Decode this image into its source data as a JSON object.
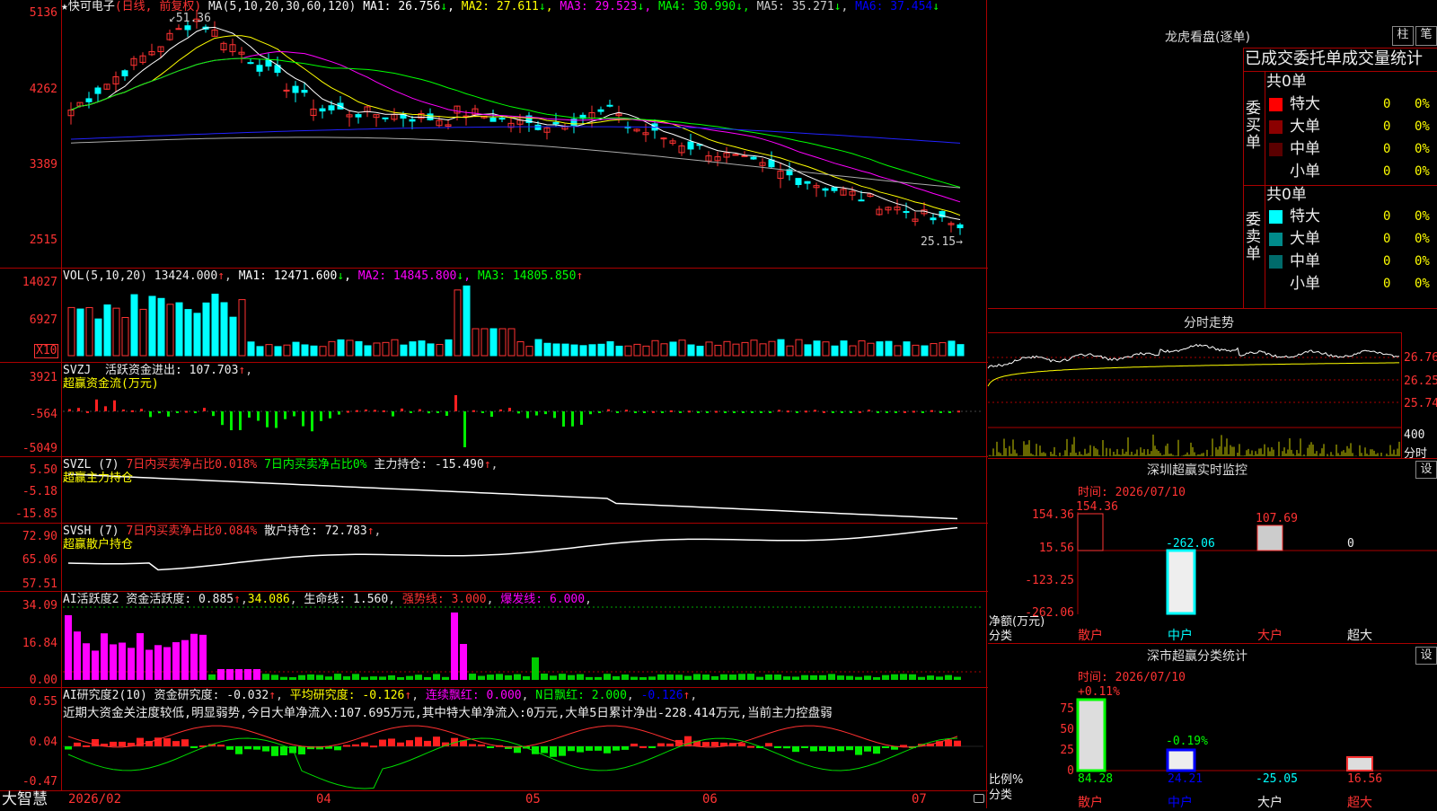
{
  "main": {
    "stock_name": "快可电子",
    "period_label": "(日线, 前复权)",
    "ma_header": "MA(5,10,20,30,60,120)",
    "ma": [
      {
        "label": "MA1:",
        "value": "26.756",
        "arrow": "↓",
        "color": "#ffffff"
      },
      {
        "label": "MA2:",
        "value": "27.611",
        "arrow": "↓",
        "color": "#ffff00"
      },
      {
        "label": "MA3:",
        "value": "29.523",
        "arrow": "↓",
        "color": "#ff00ff"
      },
      {
        "label": "MA4:",
        "value": "30.990",
        "arrow": "↓",
        "color": "#00ff00"
      },
      {
        "label": "MA5:",
        "value": "35.271",
        "arrow": "↓",
        "color": "#cccccc"
      },
      {
        "label": "MA6:",
        "value": "37.454",
        "arrow": "↓",
        "color": "#0000ff"
      }
    ],
    "high_label": "51.36",
    "low_label": "25.15",
    "y_ticks": [
      "5136",
      "4262",
      "3389",
      "2515"
    ]
  },
  "vol": {
    "header": "VOL(5,10,20)",
    "value": "13424.000",
    "ma": [
      {
        "label": "MA1:",
        "value": "12471.600",
        "arrow": "↓",
        "color": "#ffffff"
      },
      {
        "label": "MA2:",
        "value": "14845.800",
        "arrow": "↓",
        "color": "#ff00ff"
      },
      {
        "label": "MA3:",
        "value": "14805.850",
        "arrow": "↑",
        "color": "#00ff00"
      }
    ],
    "y_ticks": [
      "14027",
      "6927"
    ],
    "unit": "X10"
  },
  "svzj": {
    "name": "SVZJ",
    "label": "活跃资金进出:",
    "value": "107.703",
    "arrow": "↑",
    "sub": "超赢资金流(万元)",
    "y_ticks": [
      "3921",
      "-564",
      "-5049"
    ]
  },
  "svzl": {
    "name": "SVZL (7)",
    "a": "7日内买卖净占比0.018%",
    "b": "7日内买卖净占比0%",
    "c_label": "主力持仓:",
    "c_value": "-15.490",
    "arrow": "↑",
    "sub": "超赢主力持仓",
    "y_ticks": [
      "5.50",
      "-5.18",
      "-15.85"
    ]
  },
  "svsh": {
    "name": "SVSH (7)",
    "a": "7日内买卖净占比0.084%",
    "c_label": "散户持仓:",
    "c_value": "72.783",
    "arrow": "↑",
    "sub": "超赢散户持仓",
    "y_ticks": [
      "72.90",
      "65.06",
      "57.51"
    ]
  },
  "ai_active": {
    "name": "AI活跃度2",
    "label": "资金活跃度:",
    "value": "0.885",
    "v2": "34.086",
    "life_label": "生命线:",
    "life": "1.560",
    "strong": "强势线: 3.000",
    "burst": "爆发线: 6.000",
    "y_ticks": [
      "34.09",
      "16.84",
      "0.00"
    ]
  },
  "ai_research": {
    "name": "AI研究度2(10)",
    "label": "资金研究度:",
    "value": "-0.032",
    "avg_label": "平均研究度:",
    "avg": "-0.126",
    "red_label": "连续飘红:",
    "red": "0.000",
    "nred_label": "N日飘红:",
    "nred": "2.000",
    "last": "-0.126",
    "summary": "近期大资金关注度较低,明显弱势,今日大单净流入:107.695万元,其中特大单净流入:0万元,大单5日累计净出-228.414万元,当前主力控盘弱",
    "y_ticks": [
      "0.55",
      "0.04",
      "-0.47"
    ]
  },
  "footer": {
    "brand": "大智慧",
    "dates": [
      "2026/02",
      "04",
      "05",
      "06",
      "07"
    ]
  },
  "right": {
    "lhb_title": "龙虎看盘(逐单)",
    "btn_bar": "柱",
    "btn_pen": "笔",
    "stats_title": "已成交委托单成交量统计",
    "buy_side": "委买单",
    "sell_side": "委卖单",
    "total_buy": "共0单",
    "total_sell": "共0单",
    "rows": [
      {
        "name": "特大",
        "count": "0",
        "pct": "0%"
      },
      {
        "name": "大单",
        "count": "0",
        "pct": "0%"
      },
      {
        "name": "中单",
        "count": "0",
        "pct": "0%"
      },
      {
        "name": "小单",
        "count": "0",
        "pct": "0%"
      }
    ],
    "buy_colors": [
      "#ff0000",
      "#8b0000",
      "#5a0000",
      ""
    ],
    "sell_colors": [
      "#00ffff",
      "#008b8b",
      "#006b6b",
      ""
    ],
    "intraday_title": "分时走势",
    "intraday_ticks": [
      "26.76",
      "26.25",
      "25.74"
    ],
    "intraday_vol_tick": "400",
    "intraday_vol_unit": "分时",
    "sz_title": "深圳超赢实时监控",
    "sz_btn": "设",
    "sz_time": "时间: 2026/07/10",
    "sz_ticks": [
      "154.36",
      "15.56",
      "-123.25",
      "-262.06"
    ],
    "sz_values": [
      "154.36",
      "-262.06",
      "107.69",
      "0"
    ],
    "sz_ylabel": "净额(万元)",
    "sz_xlabel": "分类",
    "cats": [
      "散户",
      "中户",
      "大户",
      "超大"
    ],
    "cls_title": "深市超赢分类统计",
    "cls_btn": "设",
    "cls_time": "时间: 2026/07/10",
    "cls_top": [
      "+0.11%",
      "-0.19%"
    ],
    "cls_ticks": [
      "75",
      "50",
      "25",
      "0"
    ],
    "cls_values": [
      "84.28",
      "24.21",
      "-25.05",
      "16.56"
    ],
    "cls_ylabel": "比例%",
    "cls_xlabel": "分类"
  }
}
